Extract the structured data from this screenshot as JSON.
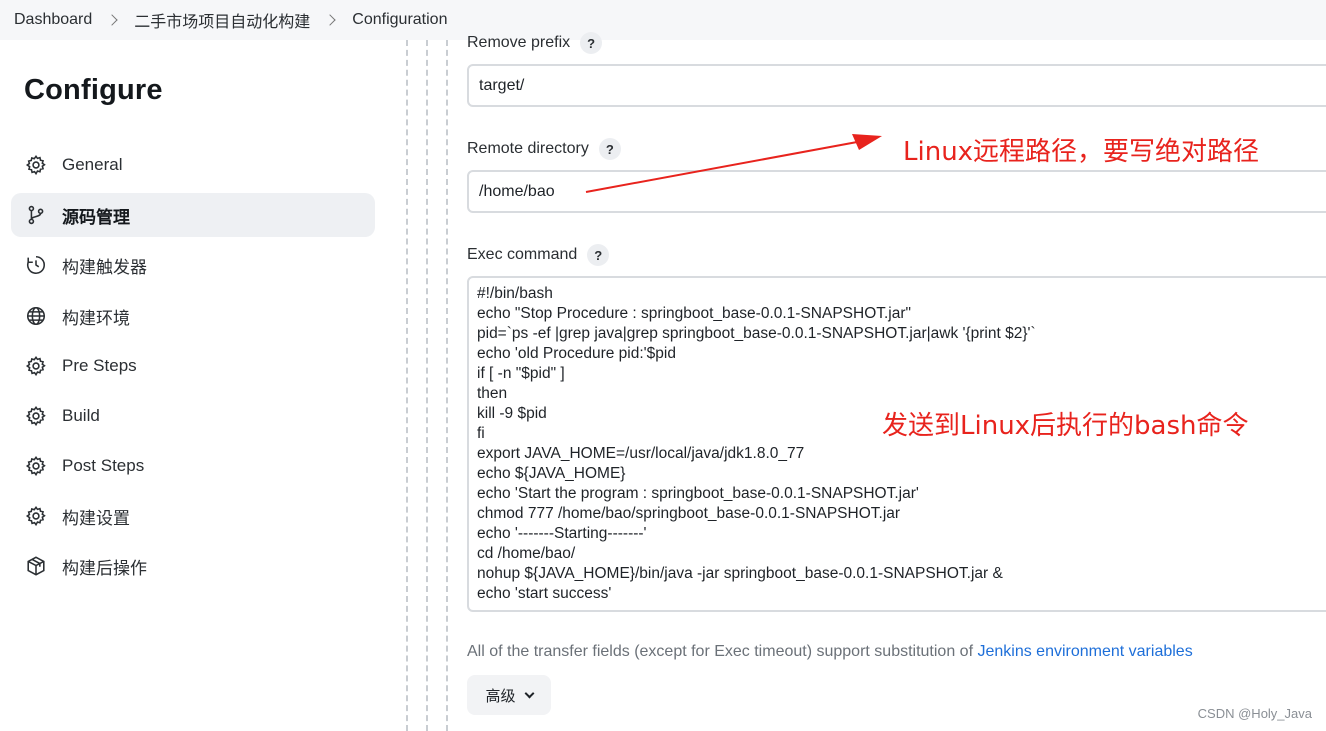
{
  "breadcrumb": [
    "Dashboard",
    "二手市场项目自动化构建",
    "Configuration"
  ],
  "sidebar": {
    "title": "Configure",
    "items": [
      {
        "label": "General",
        "icon": "gear-icon"
      },
      {
        "label": "源码管理",
        "icon": "branch-icon",
        "active": true
      },
      {
        "label": "构建触发器",
        "icon": "clock-icon"
      },
      {
        "label": "构建环境",
        "icon": "globe-icon"
      },
      {
        "label": "Pre Steps",
        "icon": "gear-icon"
      },
      {
        "label": "Build",
        "icon": "gear-icon"
      },
      {
        "label": "Post Steps",
        "icon": "gear-icon"
      },
      {
        "label": "构建设置",
        "icon": "gear-icon"
      },
      {
        "label": "构建后操作",
        "icon": "package-icon"
      }
    ]
  },
  "form": {
    "remove_prefix": {
      "label": "Remove prefix",
      "value": "target/"
    },
    "remote_directory": {
      "label": "Remote directory",
      "value": "/home/bao"
    },
    "exec_command": {
      "label": "Exec command",
      "value": "#!/bin/bash\necho \"Stop Procedure : springboot_base-0.0.1-SNAPSHOT.jar\"\npid=`ps -ef |grep java|grep springboot_base-0.0.1-SNAPSHOT.jar|awk '{print $2}'`\necho 'old Procedure pid:'$pid\nif [ -n \"$pid\" ]\nthen\nkill -9 $pid\nfi\nexport JAVA_HOME=/usr/local/java/jdk1.8.0_77\necho ${JAVA_HOME}\necho 'Start the program : springboot_base-0.0.1-SNAPSHOT.jar'\nchmod 777 /home/bao/springboot_base-0.0.1-SNAPSHOT.jar\necho '-------Starting-------'\ncd /home/bao/\nnohup ${JAVA_HOME}/bin/java -jar springboot_base-0.0.1-SNAPSHOT.jar &\necho 'start success'"
    },
    "help_glyph": "?",
    "note_text": "All of the transfer fields (except for Exec timeout) support substitution of ",
    "note_link": "Jenkins environment variables",
    "advanced_label": "高级"
  },
  "annotations": {
    "remote_path": "Linux远程路径，要写绝对路径",
    "bash_command": "发送到Linux后执行的bash命令",
    "color": "#e8231d"
  },
  "watermark": "CSDN @Holy_Java"
}
